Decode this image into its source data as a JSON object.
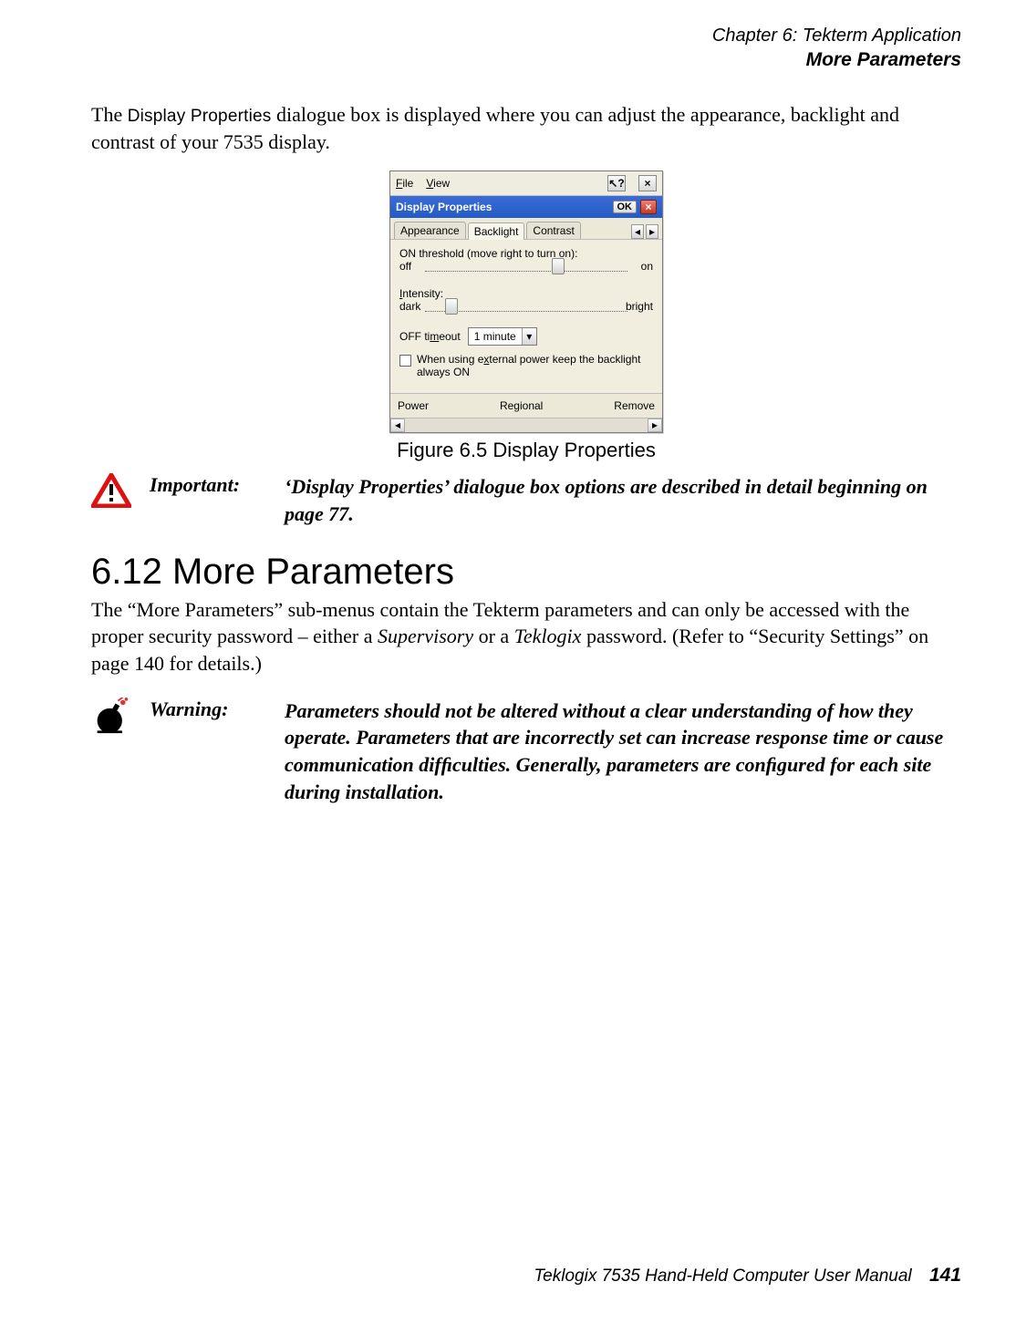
{
  "header": {
    "chapter": "Chapter 6: Tekterm Application",
    "section_title": "More Parameters"
  },
  "para1_pre": "The ",
  "para1_display_properties": "Display Properties",
  "para1_post": " dialogue box is displayed where you can adjust the appearance, backlight and contrast of your 7535 display.",
  "figure": {
    "caption": "Figure 6.5 Display Properties",
    "menubar": {
      "file": "File",
      "view": "View",
      "help": "?",
      "close": "×"
    },
    "titlebar": {
      "title": "Display Properties",
      "ok": "OK"
    },
    "tabs": {
      "appearance": "Appearance",
      "backlight": "Backlight",
      "contrast": "Contrast"
    },
    "panel": {
      "on_threshold_label": "ON threshold (move right to turn on):",
      "on_left": "off",
      "on_right": "on",
      "intensity_label": "Intensity:",
      "intensity_left": "dark",
      "intensity_right": "bright",
      "timeout_label": "OFF timeout",
      "timeout_value": "1 minute",
      "checkbox_label": "When using external power keep the backlight always ON"
    },
    "bottombar": {
      "power": "Power",
      "regional": "Regional",
      "remove": "Remove"
    }
  },
  "important": {
    "label": "Important:",
    "text": "‘Display Properties’ dialogue box options are described in detail beginning on page 77."
  },
  "section": {
    "heading": "6.12  More Parameters",
    "text_pre": "The “More Parameters” sub-menus contain the Tekterm parameters and can only be accessed with the proper security password – either a ",
    "supervisory": "Supervisory",
    "text_mid": " or a ",
    "teklogix": "Teklogix",
    "text_post": " password. (Refer to “Security Settings” on page 140 for details.)"
  },
  "warning": {
    "label": "Warning:",
    "text": "Parameters should not be altered without a clear understanding of how they operate. Parameters that are incorrectly set can increase response time or cause communication difﬁculties. Generally, parameters are conﬁgured for each site during installation."
  },
  "footer": {
    "manual": "Teklogix 7535 Hand-Held Computer User Manual",
    "page": "141"
  }
}
